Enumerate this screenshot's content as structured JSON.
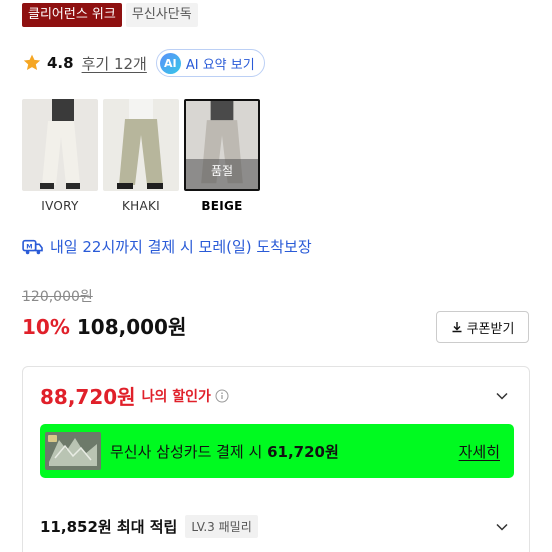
{
  "badges": {
    "clearance": "클리어런스 위크",
    "exclusive": "무신사단독"
  },
  "rating": {
    "value": "4.8",
    "reviews": "후기 12개"
  },
  "ai_summary": {
    "icon_text": "AI",
    "label": "AI 요약 보기"
  },
  "colors_options": [
    {
      "label": "IVORY",
      "selected": false,
      "soldout": false
    },
    {
      "label": "KHAKI",
      "selected": false,
      "soldout": false
    },
    {
      "label": "BEIGE",
      "selected": true,
      "soldout": true,
      "soldout_text": "품절"
    }
  ],
  "delivery": {
    "text": "내일 22시까지 결제 시 모레(일) 도착보장"
  },
  "pricing": {
    "original": "120,000원",
    "discount": "10%",
    "price": "108,000원",
    "coupon": "쿠폰받기"
  },
  "benefits": {
    "best_price": "88,720원",
    "best_price_label": "나의 할인가",
    "card_promo": {
      "text": "무신사 삼성카드 결제 시 ",
      "amount": "61,720원",
      "link": "자세히"
    },
    "points": "11,852원 최대 적립",
    "level": "LV.3 패밀리"
  },
  "theme": {
    "accent_red": "#e0202a",
    "link_blue": "#2a5bd7",
    "promo_green": "#00fa20",
    "badge_red": "#8e1010"
  }
}
